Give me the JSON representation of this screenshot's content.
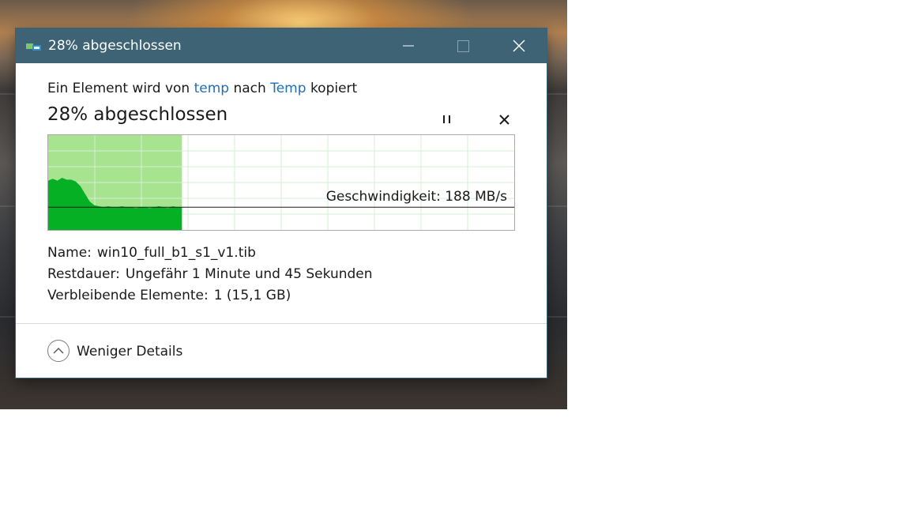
{
  "window": {
    "title": "28% abgeschlossen",
    "titlebar_color": "#3d6374",
    "controls": {
      "minimize": "minimize-icon",
      "maximize": "maximize-icon",
      "close": "close-icon"
    }
  },
  "copy_line": {
    "prefix": "Ein Element wird von",
    "source": "temp",
    "middle": "nach",
    "destination": "Temp",
    "suffix": "kopiert"
  },
  "progress": {
    "heading": "28% abgeschlossen",
    "fraction": 0.287,
    "pause_icon": "pause-icon",
    "cancel_icon": "close-icon"
  },
  "speed_graph": {
    "label": "Geschwindigkeit: 188 MB/s",
    "current_speed_fraction": 0.24,
    "history": [
      0.52,
      0.54,
      0.52,
      0.55,
      0.53,
      0.53,
      0.51,
      0.46,
      0.38,
      0.3,
      0.26,
      0.25,
      0.24,
      0.25,
      0.24,
      0.24,
      0.25,
      0.24,
      0.24,
      0.23,
      0.24,
      0.24,
      0.23,
      0.24,
      0.25,
      0.24,
      0.23,
      0.25,
      0.24,
      0.24
    ],
    "colors": {
      "done": "#a8e38f",
      "area": "#06b025",
      "grid": "#d4efd4",
      "border": "#aaaaaa"
    }
  },
  "details": {
    "name_label": "Name:",
    "name_value": "win10_full_b1_s1_v1.tib",
    "time_label": "Restdauer:",
    "time_value": "Ungefähr 1 Minute und 45 Sekunden",
    "items_label": "Verbleibende Elemente:",
    "items_value": "1 (15,1 GB)"
  },
  "footer": {
    "toggle_label": "Weniger Details",
    "toggle_icon": "chevron-up-icon"
  }
}
